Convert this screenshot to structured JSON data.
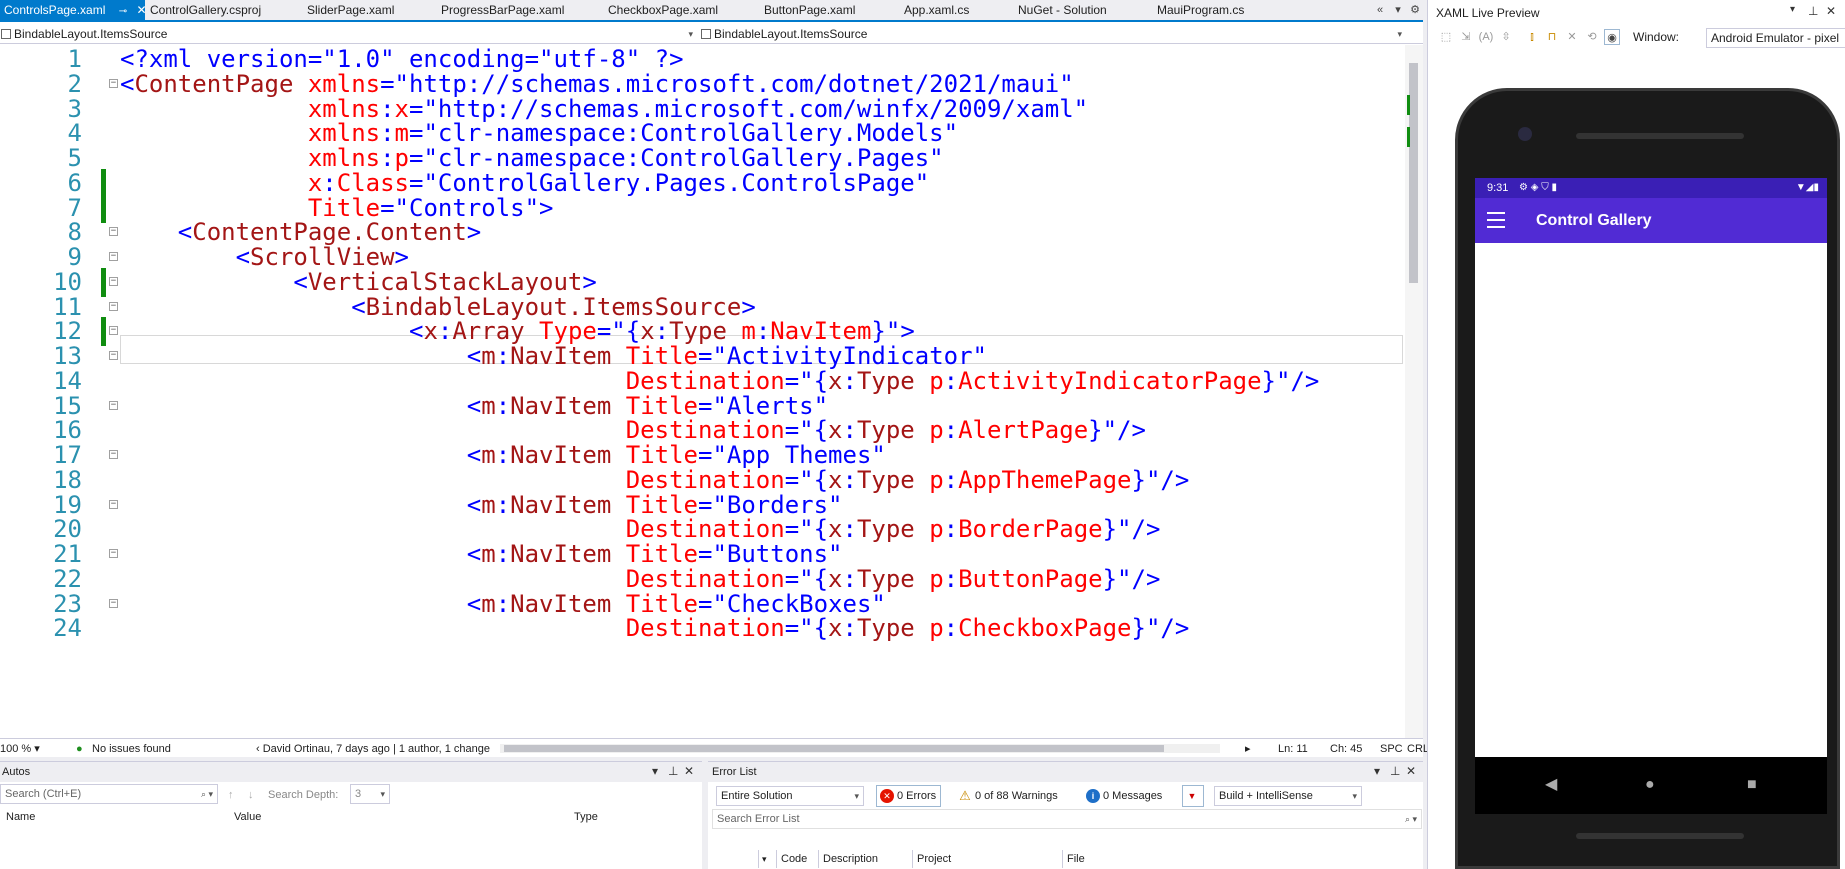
{
  "tabs": [
    {
      "label": "ControlsPage.xaml",
      "active": true
    },
    {
      "label": "ControlGallery.csproj"
    },
    {
      "label": "SliderPage.xaml"
    },
    {
      "label": "ProgressBarPage.xaml"
    },
    {
      "label": "CheckboxPage.xaml"
    },
    {
      "label": "ButtonPage.xaml"
    },
    {
      "label": "App.xaml.cs"
    },
    {
      "label": "NuGet - Solution"
    },
    {
      "label": "MauiProgram.cs"
    }
  ],
  "nav_bar": {
    "left": "BindableLayout.ItemsSource",
    "right": "BindableLayout.ItemsSource"
  },
  "code_lines": [
    {
      "n": "1",
      "tokens": [
        [
          "p",
          "<?xml version=\"1.0\" encoding=\"utf-8\" ?>"
        ]
      ]
    },
    {
      "n": "2",
      "tokens": [
        [
          "p",
          "<"
        ],
        [
          "e",
          "ContentPage"
        ],
        [
          "p",
          " "
        ],
        [
          "a",
          "xmlns"
        ],
        [
          "p",
          "=\"http://schemas.microsoft.com/dotnet/2021/maui\""
        ]
      ]
    },
    {
      "n": "3",
      "tokens": [
        [
          "p",
          "             "
        ],
        [
          "a",
          "xmlns"
        ],
        [
          "p",
          ":"
        ],
        [
          "a",
          "x"
        ],
        [
          "p",
          "=\"http://schemas.microsoft.com/winfx/2009/xaml\""
        ]
      ]
    },
    {
      "n": "4",
      "tokens": [
        [
          "p",
          "             "
        ],
        [
          "a",
          "xmlns"
        ],
        [
          "p",
          ":"
        ],
        [
          "a",
          "m"
        ],
        [
          "p",
          "=\"clr-namespace:ControlGallery.Models\""
        ]
      ]
    },
    {
      "n": "5",
      "tokens": [
        [
          "p",
          "             "
        ],
        [
          "a",
          "xmlns"
        ],
        [
          "p",
          ":"
        ],
        [
          "a",
          "p"
        ],
        [
          "p",
          "=\"clr-namespace:ControlGallery.Pages\""
        ]
      ]
    },
    {
      "n": "6",
      "tokens": [
        [
          "p",
          "             "
        ],
        [
          "a",
          "x"
        ],
        [
          "p",
          ":"
        ],
        [
          "a",
          "Class"
        ],
        [
          "p",
          "=\"ControlGallery.Pages.ControlsPage\""
        ]
      ]
    },
    {
      "n": "7",
      "tokens": [
        [
          "p",
          "             "
        ],
        [
          "a",
          "Title"
        ],
        [
          "p",
          "=\"Controls\">"
        ]
      ]
    },
    {
      "n": "8",
      "tokens": [
        [
          "p",
          "    <"
        ],
        [
          "e",
          "ContentPage.Content"
        ],
        [
          "p",
          ">"
        ]
      ]
    },
    {
      "n": "9",
      "tokens": [
        [
          "p",
          "        <"
        ],
        [
          "e",
          "ScrollView"
        ],
        [
          "p",
          ">"
        ]
      ]
    },
    {
      "n": "10",
      "tokens": [
        [
          "p",
          "            <"
        ],
        [
          "e",
          "VerticalStackLayout"
        ],
        [
          "p",
          ">"
        ]
      ]
    },
    {
      "n": "11",
      "tokens": [
        [
          "p",
          "                <"
        ],
        [
          "e",
          "BindableLayout.ItemsSource"
        ],
        [
          "p",
          ">"
        ]
      ]
    },
    {
      "n": "12",
      "tokens": [
        [
          "p",
          "                    <"
        ],
        [
          "e",
          "x"
        ],
        [
          "p",
          ":"
        ],
        [
          "e",
          "Array"
        ],
        [
          "p",
          " "
        ],
        [
          "a",
          "Type"
        ],
        [
          "p",
          "=\"{"
        ],
        [
          "e",
          "x"
        ],
        [
          "p",
          ":"
        ],
        [
          "e",
          "Type"
        ],
        [
          "p",
          " "
        ],
        [
          "a",
          "m"
        ],
        [
          "p",
          ":"
        ],
        [
          "a",
          "NavItem"
        ],
        [
          "p",
          "}\">"
        ]
      ]
    },
    {
      "n": "13",
      "tokens": [
        [
          "p",
          "                        <"
        ],
        [
          "e",
          "m"
        ],
        [
          "p",
          ":"
        ],
        [
          "e",
          "NavItem"
        ],
        [
          "p",
          " "
        ],
        [
          "a",
          "Title"
        ],
        [
          "p",
          "=\"ActivityIndicator\""
        ]
      ]
    },
    {
      "n": "14",
      "tokens": [
        [
          "p",
          "                                   "
        ],
        [
          "a",
          "Destination"
        ],
        [
          "p",
          "=\"{"
        ],
        [
          "e",
          "x"
        ],
        [
          "p",
          ":"
        ],
        [
          "e",
          "Type"
        ],
        [
          "p",
          " "
        ],
        [
          "a",
          "p"
        ],
        [
          "p",
          ":"
        ],
        [
          "a",
          "ActivityIndicatorPage"
        ],
        [
          "p",
          "}\"/>"
        ]
      ]
    },
    {
      "n": "15",
      "tokens": [
        [
          "p",
          "                        <"
        ],
        [
          "e",
          "m"
        ],
        [
          "p",
          ":"
        ],
        [
          "e",
          "NavItem"
        ],
        [
          "p",
          " "
        ],
        [
          "a",
          "Title"
        ],
        [
          "p",
          "=\"Alerts\""
        ]
      ]
    },
    {
      "n": "16",
      "tokens": [
        [
          "p",
          "                                   "
        ],
        [
          "a",
          "Destination"
        ],
        [
          "p",
          "=\"{"
        ],
        [
          "e",
          "x"
        ],
        [
          "p",
          ":"
        ],
        [
          "e",
          "Type"
        ],
        [
          "p",
          " "
        ],
        [
          "a",
          "p"
        ],
        [
          "p",
          ":"
        ],
        [
          "a",
          "AlertPage"
        ],
        [
          "p",
          "}\"/>"
        ]
      ]
    },
    {
      "n": "17",
      "tokens": [
        [
          "p",
          "                        <"
        ],
        [
          "e",
          "m"
        ],
        [
          "p",
          ":"
        ],
        [
          "e",
          "NavItem"
        ],
        [
          "p",
          " "
        ],
        [
          "a",
          "Title"
        ],
        [
          "p",
          "=\"App Themes\""
        ]
      ]
    },
    {
      "n": "18",
      "tokens": [
        [
          "p",
          "                                   "
        ],
        [
          "a",
          "Destination"
        ],
        [
          "p",
          "=\"{"
        ],
        [
          "e",
          "x"
        ],
        [
          "p",
          ":"
        ],
        [
          "e",
          "Type"
        ],
        [
          "p",
          " "
        ],
        [
          "a",
          "p"
        ],
        [
          "p",
          ":"
        ],
        [
          "a",
          "AppThemePage"
        ],
        [
          "p",
          "}\"/>"
        ]
      ]
    },
    {
      "n": "19",
      "tokens": [
        [
          "p",
          "                        <"
        ],
        [
          "e",
          "m"
        ],
        [
          "p",
          ":"
        ],
        [
          "e",
          "NavItem"
        ],
        [
          "p",
          " "
        ],
        [
          "a",
          "Title"
        ],
        [
          "p",
          "=\"Borders\""
        ]
      ]
    },
    {
      "n": "20",
      "tokens": [
        [
          "p",
          "                                   "
        ],
        [
          "a",
          "Destination"
        ],
        [
          "p",
          "=\"{"
        ],
        [
          "e",
          "x"
        ],
        [
          "p",
          ":"
        ],
        [
          "e",
          "Type"
        ],
        [
          "p",
          " "
        ],
        [
          "a",
          "p"
        ],
        [
          "p",
          ":"
        ],
        [
          "a",
          "BorderPage"
        ],
        [
          "p",
          "}\"/>"
        ]
      ]
    },
    {
      "n": "21",
      "tokens": [
        [
          "p",
          "                        <"
        ],
        [
          "e",
          "m"
        ],
        [
          "p",
          ":"
        ],
        [
          "e",
          "NavItem"
        ],
        [
          "p",
          " "
        ],
        [
          "a",
          "Title"
        ],
        [
          "p",
          "=\"Buttons\""
        ]
      ]
    },
    {
      "n": "22",
      "tokens": [
        [
          "p",
          "                                   "
        ],
        [
          "a",
          "Destination"
        ],
        [
          "p",
          "=\"{"
        ],
        [
          "e",
          "x"
        ],
        [
          "p",
          ":"
        ],
        [
          "e",
          "Type"
        ],
        [
          "p",
          " "
        ],
        [
          "a",
          "p"
        ],
        [
          "p",
          ":"
        ],
        [
          "a",
          "ButtonPage"
        ],
        [
          "p",
          "}\"/>"
        ]
      ]
    },
    {
      "n": "23",
      "tokens": [
        [
          "p",
          "                        <"
        ],
        [
          "e",
          "m"
        ],
        [
          "p",
          ":"
        ],
        [
          "e",
          "NavItem"
        ],
        [
          "p",
          " "
        ],
        [
          "a",
          "Title"
        ],
        [
          "p",
          "=\"CheckBoxes\""
        ]
      ]
    },
    {
      "n": "24",
      "tokens": [
        [
          "p",
          "                                   "
        ],
        [
          "a",
          "Destination"
        ],
        [
          "p",
          "=\"{"
        ],
        [
          "e",
          "x"
        ],
        [
          "p",
          ":"
        ],
        [
          "e",
          "Type"
        ],
        [
          "p",
          " "
        ],
        [
          "a",
          "p"
        ],
        [
          "p",
          ":"
        ],
        [
          "a",
          "CheckboxPage"
        ],
        [
          "p",
          "}\"/>"
        ]
      ]
    }
  ],
  "status": {
    "zoom": "100 %",
    "issues": "No issues found",
    "blame": "David Ortinau, 7 days ago | 1 author, 1 change",
    "ln": "Ln: 11",
    "ch": "Ch: 45",
    "spc": "SPC",
    "crlf": "CRLF"
  },
  "autos": {
    "title": "Autos",
    "search_placeholder": "Search (Ctrl+E)",
    "search_depth_label": "Search Depth:",
    "search_depth_value": "3",
    "columns": [
      "Name",
      "Value",
      "Type"
    ]
  },
  "error_list": {
    "title": "Error List",
    "scope": "Entire Solution",
    "errors": "0 Errors",
    "warnings": "0 of 88 Warnings",
    "messages": "0 Messages",
    "build_filter": "Build + IntelliSense",
    "search_placeholder": "Search Error List",
    "columns": [
      "Code",
      "Description",
      "Project",
      "File"
    ]
  },
  "preview": {
    "title": "XAML Live Preview",
    "window_label": "Window:",
    "window_value": "Android Emulator - pixel",
    "status_time": "9:31",
    "app_title": "Control Gallery"
  },
  "colors": {
    "accent": "#007acc",
    "app_bar": "#512bd4",
    "status_bar": "#3a1fb5"
  }
}
